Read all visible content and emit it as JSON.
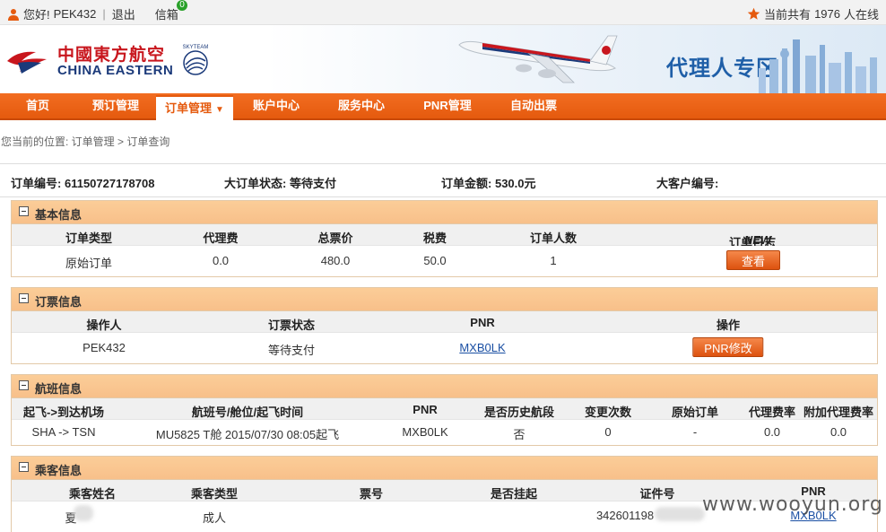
{
  "topbar": {
    "greeting": "您好!",
    "username": "PEK432",
    "separator": "|",
    "logout": "退出",
    "inbox": "信箱",
    "inbox_count": "0",
    "online_prefix": "当前共有",
    "online_count": "1976",
    "online_suffix": "人在线"
  },
  "header": {
    "logo_cn": "中國東方航空",
    "logo_en": "CHINA EASTERN",
    "skyteam": "SKYTEAM",
    "zone_title": "代理人专区"
  },
  "nav": {
    "items": [
      {
        "label": "首页"
      },
      {
        "label": "预订管理"
      },
      {
        "label": "订单管理"
      },
      {
        "label": "账户中心"
      },
      {
        "label": "服务中心"
      },
      {
        "label": "PNR管理"
      },
      {
        "label": "自动出票"
      }
    ]
  },
  "breadcrumb": "您当前的位置: 订单管理 > 订单查询",
  "summary": {
    "order_no_label": "订单编号:",
    "order_no": "61150727178708",
    "status_label": "大订单状态:",
    "status": "等待支付",
    "amount_label": "订单金额:",
    "amount": "530.0元",
    "customer_label": "大客户编号:",
    "customer": ""
  },
  "basic": {
    "title": "基本信息",
    "headers": [
      "订单类型",
      "代理费",
      "总票价",
      "税费",
      "订单人数",
      "订单日志"
    ],
    "new_tag": "NEW",
    "row": [
      "原始订单",
      "0.0",
      "480.0",
      "50.0",
      "1"
    ],
    "view_button": "查看"
  },
  "ticketing": {
    "title": "订票信息",
    "headers": [
      "操作人",
      "订票状态",
      "PNR",
      "操作"
    ],
    "row": [
      "PEK432",
      "等待支付",
      "MXB0LK"
    ],
    "edit_button": "PNR修改"
  },
  "flight": {
    "title": "航班信息",
    "headers": [
      "起飞->到达机场",
      "航班号/舱位/起飞时间",
      "PNR",
      "是否历史航段",
      "变更次数",
      "原始订单",
      "代理费率",
      "附加代理费率"
    ],
    "row": [
      "SHA -> TSN",
      "MU5825 T舱 2015/07/30 08:05起飞",
      "MXB0LK",
      "否",
      "0",
      "-",
      "0.0",
      "0.0"
    ]
  },
  "passenger": {
    "title": "乘客信息",
    "headers": [
      "乘客姓名",
      "乘客类型",
      "票号",
      "是否挂起",
      "证件号",
      "PNR"
    ],
    "row": [
      "夏",
      "成人",
      "",
      "",
      "342601198",
      "MXB0LK"
    ]
  },
  "watermark": "www.wooyun.org",
  "colors": {
    "nav_orange": "#e55a0e",
    "panel_header": "#f8c08a",
    "link_blue": "#1a4fa3",
    "brand_red": "#c8161d",
    "brand_navy": "#1b3a7a"
  }
}
